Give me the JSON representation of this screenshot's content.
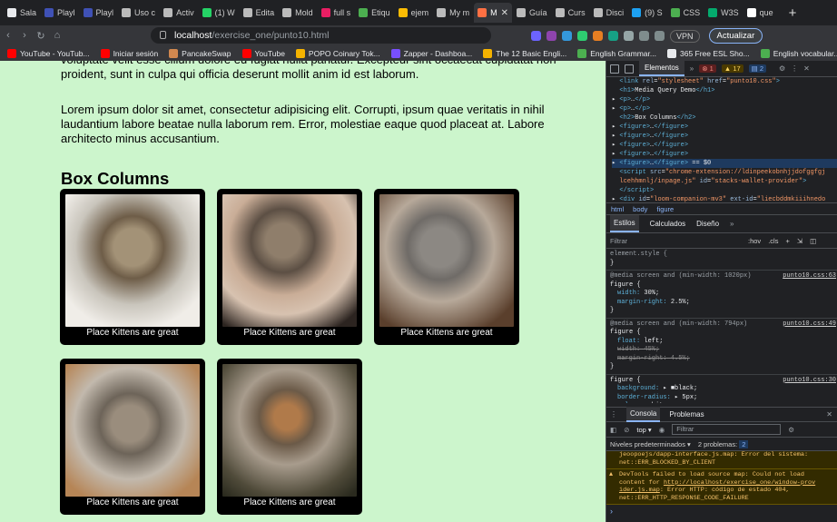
{
  "browser": {
    "tabs": [
      {
        "label": "Sala",
        "color": "#e8eaed"
      },
      {
        "label": "Playl",
        "color": "#3f51b5"
      },
      {
        "label": "Playl",
        "color": "#3f51b5"
      },
      {
        "label": "Uso c",
        "color": "#bbbbbb"
      },
      {
        "label": "Activ",
        "color": "#bbbbbb"
      },
      {
        "label": "(1) W",
        "color": "#25d366"
      },
      {
        "label": "Edita",
        "color": "#bbbbbb"
      },
      {
        "label": "Mold",
        "color": "#bbbbbb"
      },
      {
        "label": "full s",
        "color": "#e91e63"
      },
      {
        "label": "Etiqu",
        "color": "#4caf50"
      },
      {
        "label": "ejem",
        "color": "#fbbc04"
      },
      {
        "label": "My m",
        "color": "#bbbbbb"
      },
      {
        "label": "M",
        "color": "#ff7043",
        "active": true
      },
      {
        "label": "Guía",
        "color": "#bbbbbb"
      },
      {
        "label": "Curs",
        "color": "#bbbbbb"
      },
      {
        "label": "Disci",
        "color": "#bbbbbb"
      },
      {
        "label": "(9) S",
        "color": "#1da1f2"
      },
      {
        "label": "CSS",
        "color": "#4caf50"
      },
      {
        "label": "W3S",
        "color": "#04aa6d"
      },
      {
        "label": "que",
        "color": "#ffffff"
      }
    ],
    "url_host": "localhost",
    "url_path": "/exercise_one/punto10.html",
    "vpn_label": "VPN",
    "update_label": "Actualizar",
    "bookmarks": [
      {
        "label": "YouTube - YouTub...",
        "color": "#ff0000"
      },
      {
        "label": "Iniciar sesión",
        "color": "#ff0000"
      },
      {
        "label": "PancakeSwap",
        "color": "#d1884f"
      },
      {
        "label": "YouTube",
        "color": "#ff0000"
      },
      {
        "label": "POPO Coinary Tok...",
        "color": "#f5b300"
      },
      {
        "label": "Zapper - Dashboa...",
        "color": "#784ffe"
      },
      {
        "label": "The 12 Basic Engli...",
        "color": "#f5b300"
      },
      {
        "label": "English Grammar...",
        "color": "#4caf50"
      },
      {
        "label": "365 Free ESL Sho...",
        "color": "#e8eaed"
      },
      {
        "label": "English vocabular...",
        "color": "#4caf50"
      }
    ]
  },
  "page": {
    "p1": "voluptate velit esse cillum dolore eu fugiat nulla pariatur. Excepteur sint occaecat cupidatat non proident, sunt in culpa qui officia deserunt mollit anim id est laborum.",
    "p2": "Lorem ipsum dolor sit amet, consectetur adipisicing elit. Corrupti, ipsum quae veritatis in nihil laudantium labore beatae nulla laborum rem. Error, molestiae eaque quod placeat at. Labore architecto minus accusantium.",
    "heading": "Box Columns",
    "figures": [
      {
        "caption": "Place Kittens are great"
      },
      {
        "caption": "Place Kittens are great"
      },
      {
        "caption": "Place Kittens are great"
      },
      {
        "caption": "Place Kittens are great"
      },
      {
        "caption": "Place Kittens are great"
      }
    ]
  },
  "devtools": {
    "tab_elements": "Elementos",
    "errors": "1",
    "warnings": "17",
    "infos": "2",
    "crumbs": [
      "html",
      "body",
      "figure"
    ],
    "subtabs": [
      "Estilos",
      "Calculados",
      "Diseño"
    ],
    "filter_placeholder": "Filtrar",
    "hov": ":hov",
    "cls": ".cls",
    "drawer_tabs": [
      "Consola",
      "Problemas"
    ],
    "console_context": "top",
    "console_filter": "Filtrar",
    "levels": "Niveles predeterminados",
    "problems": "2 problemas:",
    "problems_count": "2"
  }
}
